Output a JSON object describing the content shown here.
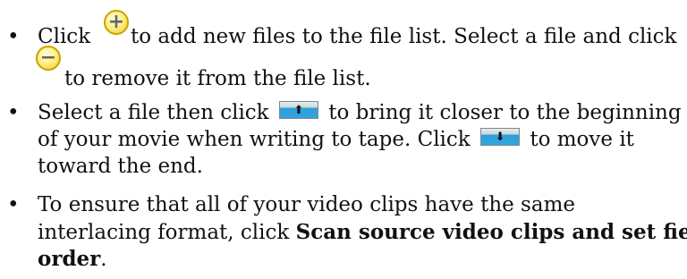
{
  "bullet_glyph": "•",
  "items": [
    {
      "lines": [
        {
          "part1": "Click",
          "part2": " to add new files to the file list. Select a file and click"
        },
        {
          "part1": " to remove it from the file list."
        }
      ]
    },
    {
      "lines": [
        {
          "part1": "Select a file then click",
          "part2": " to bring it closer to the beginning"
        },
        {
          "part1": "of your movie when writing to tape. Click",
          "part2": " to move it"
        },
        {
          "part1": "toward the end."
        }
      ]
    },
    {
      "lines": [
        {
          "part1": "To ensure that all of your video clips have the same"
        },
        {
          "part1": "interlacing format, click ",
          "bold": "Scan source video clips and set field"
        },
        {
          "bold": "order",
          "part2": "."
        }
      ]
    }
  ],
  "icons": {
    "add": {
      "name": "add-file-icon",
      "glyph": "+"
    },
    "remove": {
      "name": "remove-file-icon",
      "glyph": "−"
    },
    "move_up": {
      "name": "move-up-icon",
      "glyph": "⬆"
    },
    "move_down": {
      "name": "move-down-icon",
      "glyph": "⬇"
    }
  }
}
